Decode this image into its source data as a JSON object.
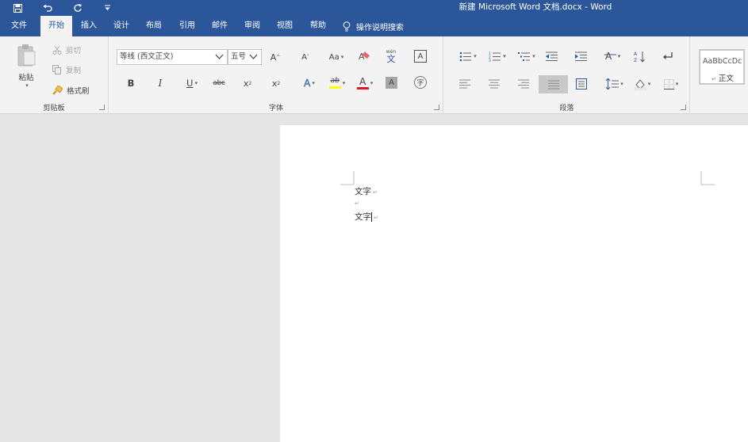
{
  "title_bar": {
    "title": "新建 Microsoft Word 文档.docx  -  Word",
    "quick_access": [
      "save-icon",
      "undo-icon",
      "redo-icon",
      "customize-qat-icon"
    ]
  },
  "tabs": [
    {
      "label": "文件",
      "active": false
    },
    {
      "label": "开始",
      "active": true
    },
    {
      "label": "插入",
      "active": false
    },
    {
      "label": "设计",
      "active": false
    },
    {
      "label": "布局",
      "active": false
    },
    {
      "label": "引用",
      "active": false
    },
    {
      "label": "邮件",
      "active": false
    },
    {
      "label": "审阅",
      "active": false
    },
    {
      "label": "视图",
      "active": false
    },
    {
      "label": "帮助",
      "active": false
    }
  ],
  "tell_me": {
    "label": "操作说明搜索"
  },
  "clipboard": {
    "group_label": "剪贴板",
    "paste": "粘贴",
    "cut": "剪切",
    "copy": "复制",
    "format_painter": "格式刷"
  },
  "font": {
    "group_label": "字体",
    "font_name": "等线 (西文正文)",
    "font_size": "五号",
    "grow": "A",
    "shrink": "A",
    "case": "Aa",
    "phonetic_top": "wén",
    "phonetic_bottom": "文",
    "border_char": "A",
    "bold": "B",
    "italic": "I",
    "underline": "U",
    "strike": "abc",
    "subscript": "x",
    "subscript_sub": "2",
    "superscript": "x",
    "superscript_sup": "2",
    "effects": "A",
    "highlight": "ab",
    "font_color": "A",
    "shading": "A",
    "enclose": "字",
    "highlight_color": "#ffff00",
    "font_color_value": "#e81123"
  },
  "paragraph": {
    "group_label": "段落"
  },
  "styles": {
    "preview": "AaBbCcDc",
    "name": "正文",
    "marker": "↵"
  },
  "document": {
    "lines": [
      {
        "text": "文字",
        "mark": "↵"
      },
      {
        "text": "",
        "mark": "↵"
      },
      {
        "text": "文字",
        "mark": "↵"
      }
    ]
  },
  "colors": {
    "ribbon_blue": "#2b579a",
    "ribbon_bg": "#f3f3f3",
    "canvas_gray": "#e6e6e6"
  }
}
